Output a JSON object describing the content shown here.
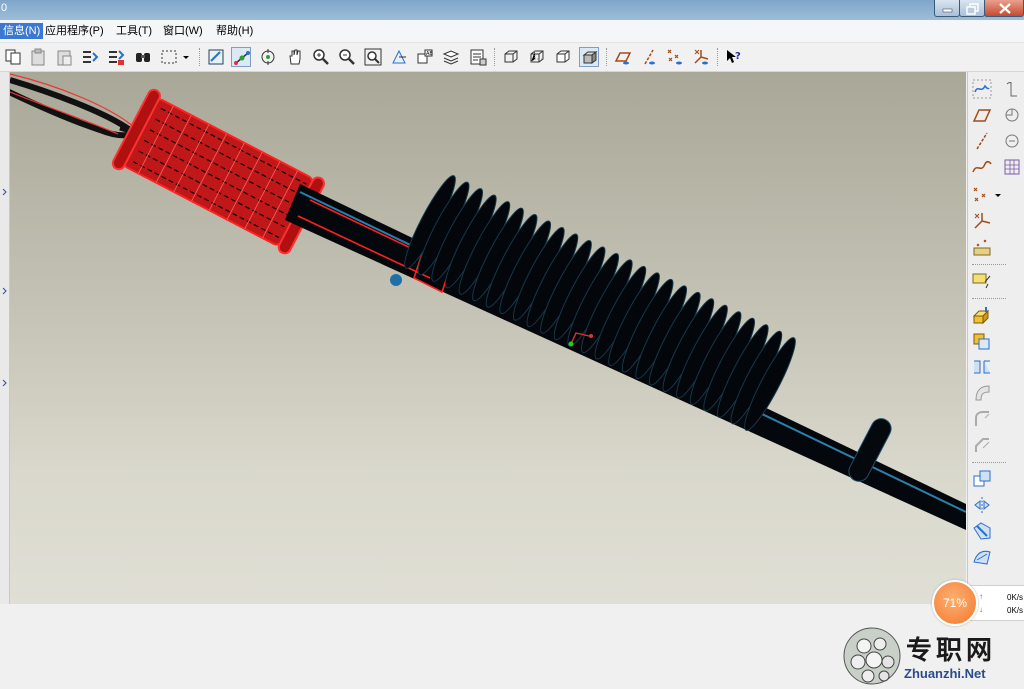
{
  "window": {
    "title_fragment": "0",
    "controls": [
      "minimize",
      "maximize",
      "close"
    ]
  },
  "menu": {
    "items": [
      "信息(N)",
      "应用程序(P)",
      "工具(T)",
      "窗口(W)",
      "帮助(H)"
    ],
    "active_index": 0,
    "visible_labels": [
      "信息(N)",
      "应用程序(P)",
      "工具(T)",
      "窗口(W)",
      "帮助(H)"
    ]
  },
  "toolbar": {
    "icons": [
      "copy-icon",
      "paste-icon",
      "paste-special-icon",
      "regenerate-icon",
      "regenerate-manager-icon",
      "find-icon",
      "select-box-icon",
      "dropdown-arrow-icon",
      "repaint-icon",
      "spin-center-icon",
      "orient-icon",
      "pan-icon",
      "zoom-in-icon",
      "zoom-out-icon",
      "refit-icon",
      "reorient-icon",
      "saved-views-icon",
      "layers-icon",
      "view-manager-icon",
      "wireframe-icon",
      "hidden-line-icon",
      "no-hidden-icon",
      "shading-icon",
      "datum-planes-icon",
      "datum-axes-icon",
      "datum-points-icon",
      "csys-icon",
      "context-help-icon"
    ],
    "active": [
      "spin-center-icon",
      "shading-icon"
    ]
  },
  "right_toolbar": {
    "icons": [
      "sketch-tool-icon",
      "datum-plane-icon",
      "datum-axis-icon",
      "datum-curve-icon",
      "datum-point-icon",
      "datum-csys-icon",
      "analysis-feature-icon",
      "annotation-icon",
      "extrude-icon",
      "revolve-icon",
      "sweep-icon",
      "blend-icon",
      "round-icon",
      "chamfer-icon",
      "hole-icon",
      "shell-icon",
      "rib-icon",
      "draft-icon",
      "pattern-icon",
      "mirror-icon",
      "merge-icon",
      "style-icon"
    ]
  },
  "network_widget": {
    "percent": "71%",
    "upload": "0K/s",
    "download": "0K/s"
  },
  "watermark": {
    "title": "专职网",
    "url": "Zhuanzhi.Net"
  },
  "colors": {
    "selection": "#ff2020",
    "model": "#050810",
    "menu_active": "#3b78d4",
    "viewport_top": "#a9a797",
    "viewport_bottom": "#e0dfd5"
  }
}
